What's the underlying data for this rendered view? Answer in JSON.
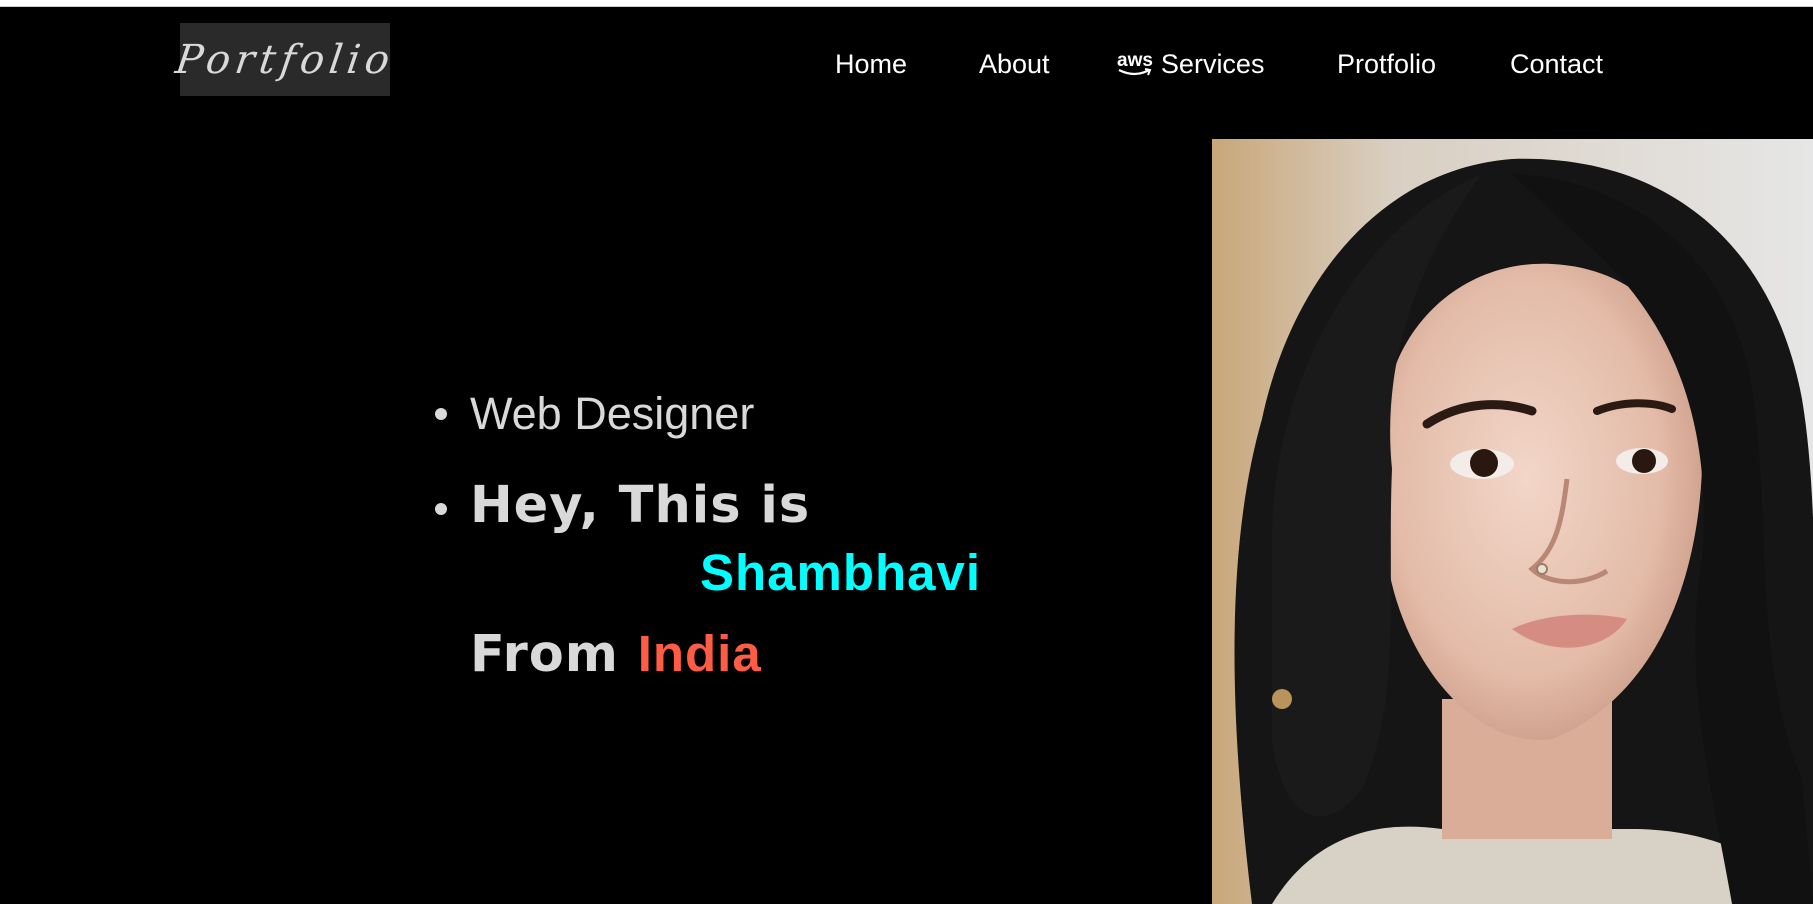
{
  "logo": {
    "text": "Portfolio"
  },
  "nav": {
    "items": [
      {
        "label": "Home"
      },
      {
        "label": "About"
      },
      {
        "label": "Services",
        "icon": "aws-icon",
        "icon_text": "aws"
      },
      {
        "label": "Protfolio"
      },
      {
        "label": "Contact"
      }
    ]
  },
  "hero": {
    "role": "Web Designer",
    "greeting": "Hey, This is",
    "name": "Shambhavi",
    "from_prefix": "From",
    "country": "India"
  },
  "colors": {
    "background": "#000000",
    "nav_text": "#ffffff",
    "body_text": "#d9d9d9",
    "name_accent": "#00ffff",
    "country_accent": "#ff5c44",
    "logo_bg": "#2a2a2a"
  }
}
